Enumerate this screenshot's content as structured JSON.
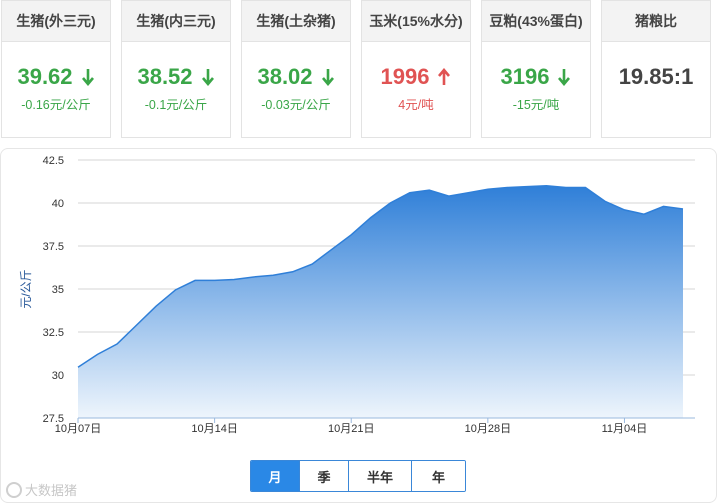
{
  "cards": [
    {
      "title": "生猪(外三元)",
      "value": "39.62",
      "change": "-0.16元/公斤",
      "trend": "down"
    },
    {
      "title": "生猪(内三元)",
      "value": "38.52",
      "change": "-0.1元/公斤",
      "trend": "down"
    },
    {
      "title": "生猪(土杂猪)",
      "value": "38.02",
      "change": "-0.03元/公斤",
      "trend": "down"
    },
    {
      "title": "玉米(15%水分)",
      "value": "1996",
      "change": "4元/吨",
      "trend": "up"
    },
    {
      "title": "豆粕(43%蛋白)",
      "value": "3196",
      "change": "-15元/吨",
      "trend": "down"
    },
    {
      "title": "猪粮比",
      "value": "19.85:1",
      "change": "",
      "trend": "none"
    }
  ],
  "colors": {
    "down": "#3aa648",
    "up": "#e05353",
    "area_top": "#2f7fd8",
    "area_bottom": "#eef5fc",
    "tab_active": "#2a88e6"
  },
  "icons": {
    "down": "arrow-down-icon",
    "up": "arrow-up-icon"
  },
  "chart_data": {
    "type": "area",
    "ylabel": "元/公斤",
    "xlabel": "",
    "ylim": [
      27.5,
      42.5
    ],
    "yticks": [
      27.5,
      30,
      32.5,
      35,
      37.5,
      40,
      42.5
    ],
    "x_tick_labels": [
      "10月07日",
      "10月14日",
      "10月21日",
      "10月28日",
      "11月04日"
    ],
    "x_tick_index": [
      0,
      7,
      14,
      21,
      28
    ],
    "x": [
      "10-07",
      "10-08",
      "10-09",
      "10-10",
      "10-11",
      "10-12",
      "10-13",
      "10-14",
      "10-15",
      "10-16",
      "10-17",
      "10-18",
      "10-19",
      "10-20",
      "10-21",
      "10-22",
      "10-23",
      "10-24",
      "10-25",
      "10-26",
      "10-27",
      "10-28",
      "10-29",
      "10-30",
      "10-31",
      "11-01",
      "11-02",
      "11-03",
      "11-04",
      "11-05",
      "11-06"
    ],
    "series": [
      {
        "values": [
          30.45,
          31.2,
          31.8,
          32.9,
          34.0,
          34.95,
          35.5,
          35.5,
          35.55,
          35.7,
          35.8,
          36.0,
          36.45,
          37.3,
          38.15,
          39.15,
          40.0,
          40.6,
          40.75,
          40.4,
          40.6,
          40.8,
          40.9,
          40.95,
          41.0,
          40.9,
          40.9,
          40.1,
          39.6,
          39.35,
          39.8,
          39.65
        ]
      }
    ]
  },
  "range_tabs": [
    "月",
    "季",
    "半年",
    "年"
  ],
  "active_tab": 0,
  "watermark": "大数据猪"
}
